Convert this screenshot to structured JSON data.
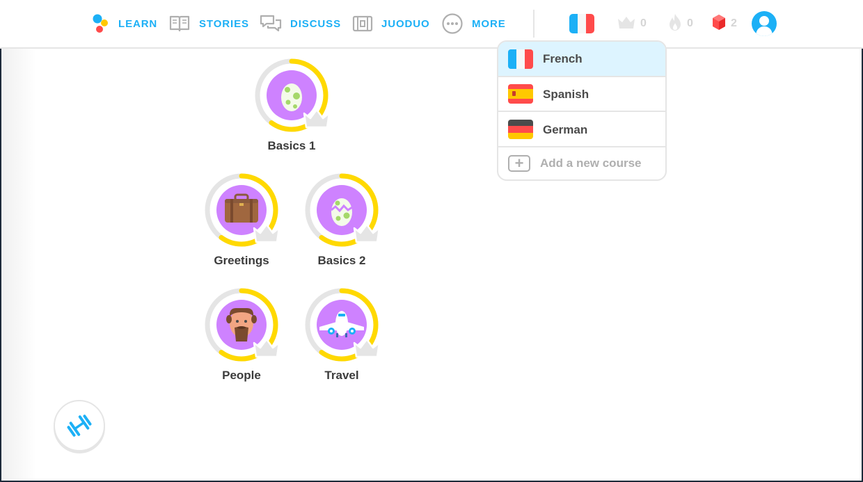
{
  "nav": {
    "learn": "LEARN",
    "stories": "STORIES",
    "discuss": "DISCUSS",
    "juoduo": "JUODUO",
    "more": "MORE"
  },
  "stats": {
    "crowns": "0",
    "streak": "0",
    "gems": "2"
  },
  "colors": {
    "accent": "#1cb0f6",
    "skill_circle": "#ce82ff",
    "progress_ring": "#ffd900",
    "ring_track": "#e5e5e5",
    "gem": "#ff4b4b",
    "selected_row": "#ddf4ff"
  },
  "course_menu": {
    "selected": "French",
    "courses": [
      {
        "name": "French",
        "flag": "france-flag"
      },
      {
        "name": "Spanish",
        "flag": "spain-flag"
      },
      {
        "name": "German",
        "flag": "germany-flag"
      }
    ],
    "add_label": "Add a new course"
  },
  "skills": [
    {
      "name": "Basics 1",
      "icon": "egg-icon",
      "progress": 0.6
    },
    {
      "name": "Greetings",
      "icon": "suitcase-icon",
      "progress": 0.6
    },
    {
      "name": "Basics 2",
      "icon": "cracked-egg-icon",
      "progress": 0.6
    },
    {
      "name": "People",
      "icon": "person-icon",
      "progress": 0.6
    },
    {
      "name": "Travel",
      "icon": "airplane-icon",
      "progress": 0.6
    }
  ],
  "practice": {
    "icon": "dumbbell-icon"
  }
}
